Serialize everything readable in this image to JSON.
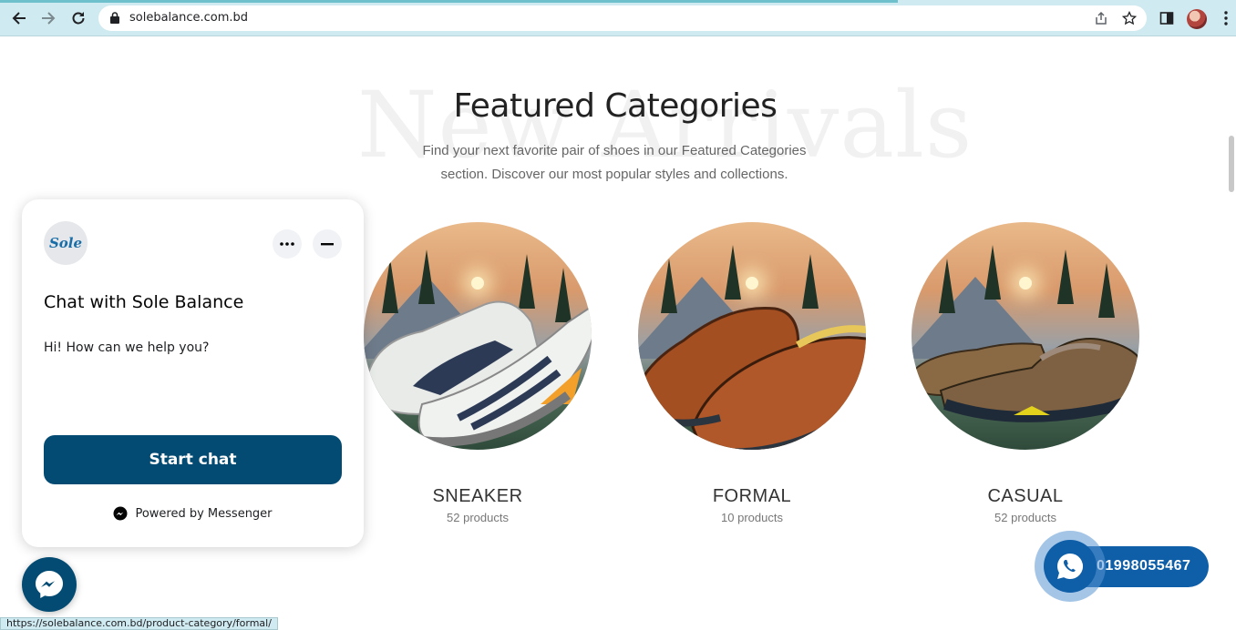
{
  "browser": {
    "url": "solebalance.com.bd",
    "status_url": "https://solebalance.com.bd/product-category/formal/"
  },
  "section": {
    "watermark": "New Arrivals",
    "title": "Featured Categories",
    "subtitle": "Find your next favorite pair of shoes in our Featured Categories section. Discover our most popular styles and collections."
  },
  "categories": [
    {
      "name": "SNEAKER",
      "count": "52 products"
    },
    {
      "name": "FORMAL",
      "count": "10 products"
    },
    {
      "name": "CASUAL",
      "count": "52 products"
    }
  ],
  "chat": {
    "logo_text": "Sole",
    "title": "Chat with Sole Balance",
    "message": "Hi! How can we help you?",
    "start_label": "Start chat",
    "powered_label": "Powered by Messenger"
  },
  "whatsapp": {
    "number": "01998055467"
  },
  "colors": {
    "chrome": "#cfeaf0",
    "brand": "#034b72",
    "whatsapp": "#0f5ea8"
  }
}
